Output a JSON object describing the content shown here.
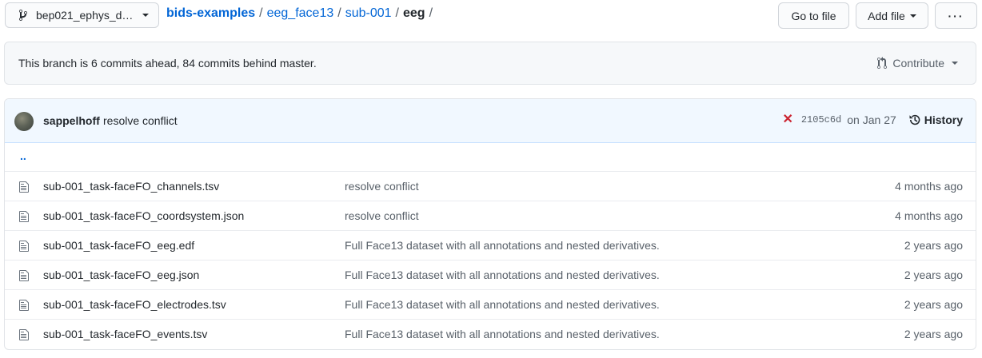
{
  "header": {
    "branch_label": "bep021_ephys_d…",
    "breadcrumb": {
      "root": "bids-examples",
      "part1": "eeg_face13",
      "part2": "sub-001",
      "current": "eeg",
      "sep": "/",
      "trailing_sep": "/"
    },
    "go_to_file": "Go to file",
    "add_file": "Add file",
    "more": "···"
  },
  "branch_info": {
    "status": "This branch is 6 commits ahead, 84 commits behind master.",
    "contribute": "Contribute"
  },
  "latest_commit": {
    "author": "sappelhoff",
    "message": "resolve conflict",
    "status_icon": "x-fail-icon",
    "status_color": "#cb2431",
    "sha": "2105c6d",
    "date": "on Jan 27",
    "history": "History"
  },
  "parent_link": "..",
  "files": [
    {
      "name": "sub-001_task-faceFO_channels.tsv",
      "message": "resolve conflict",
      "age": "4 months ago"
    },
    {
      "name": "sub-001_task-faceFO_coordsystem.json",
      "message": "resolve conflict",
      "age": "4 months ago"
    },
    {
      "name": "sub-001_task-faceFO_eeg.edf",
      "message": "Full Face13 dataset with all annotations and nested derivatives.",
      "age": "2 years ago"
    },
    {
      "name": "sub-001_task-faceFO_eeg.json",
      "message": "Full Face13 dataset with all annotations and nested derivatives.",
      "age": "2 years ago"
    },
    {
      "name": "sub-001_task-faceFO_electrodes.tsv",
      "message": "Full Face13 dataset with all annotations and nested derivatives.",
      "age": "2 years ago"
    },
    {
      "name": "sub-001_task-faceFO_events.tsv",
      "message": "Full Face13 dataset with all annotations and nested derivatives.",
      "age": "2 years ago"
    }
  ],
  "colors": {
    "link": "#0366d6",
    "commit_bar_bg": "#f1f8ff",
    "muted_text": "#586069"
  }
}
